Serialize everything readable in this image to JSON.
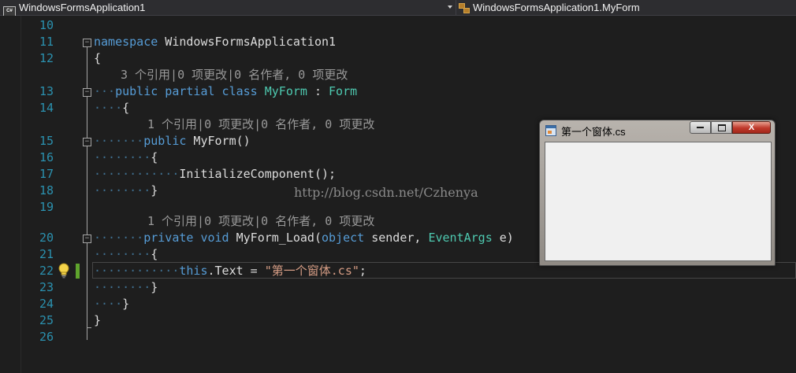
{
  "navbar": {
    "left_label": "WindowsFormsApplication1",
    "left_icon": "csharp-project-icon",
    "right_label": "WindowsFormsApplication1.MyForm",
    "right_icon": "class-icon"
  },
  "editor": {
    "lines": [
      {
        "no": "10"
      },
      {
        "no": "11"
      },
      {
        "no": "12"
      },
      {
        "no": "13"
      },
      {
        "no": "14"
      },
      {
        "no": "15"
      },
      {
        "no": "16"
      },
      {
        "no": "17"
      },
      {
        "no": "18"
      },
      {
        "no": "19"
      },
      {
        "no": "20"
      },
      {
        "no": "21"
      },
      {
        "no": "22"
      },
      {
        "no": "23"
      },
      {
        "no": "24"
      },
      {
        "no": "25"
      },
      {
        "no": "26"
      }
    ],
    "code": {
      "l11_kw": "namespace",
      "l11_name": " WindowsFormsApplication1",
      "l12": "{",
      "lens_class": "3 个引用|0 项更改|0 名作者, 0 项更改",
      "l13_kw": "public partial class",
      "l13_type": "MyForm",
      "l13_colon": " : ",
      "l13_base": "Form",
      "l14": "{",
      "lens_ctor": "1 个引用|0 项更改|0 名作者, 0 项更改",
      "l15_kw": "public",
      "l15_rest": " MyForm()",
      "l16": "{",
      "l17": "InitializeComponent();",
      "l18": "}",
      "lens_load": "1 个引用|0 项更改|0 名作者, 0 项更改",
      "l20_kw1": "private void",
      "l20_name": " MyForm_Load(",
      "l20_kw2": "object",
      "l20_p1": " sender, ",
      "l20_type": "EventArgs",
      "l20_p2": " e)",
      "l21": "{",
      "l22_kw": "this",
      "l22_mid": ".Text = ",
      "l22_str": "\"第一个窗体.cs\"",
      "l22_end": ";",
      "l23": "}",
      "l24": "}",
      "l25": "}"
    },
    "watermark": "http://blog.csdn.net/Czhenya"
  },
  "form_window": {
    "title": "第一个窗体.cs",
    "min_label": "",
    "close_label": "X"
  },
  "colors": {
    "background": "#1e1e1e",
    "line_number": "#2b91af",
    "keyword": "#569cd6",
    "type": "#4ec9b0",
    "string": "#d69d85",
    "text": "#dcdcdc",
    "code_lens": "#999999",
    "change_marker": "#5fa42d"
  }
}
